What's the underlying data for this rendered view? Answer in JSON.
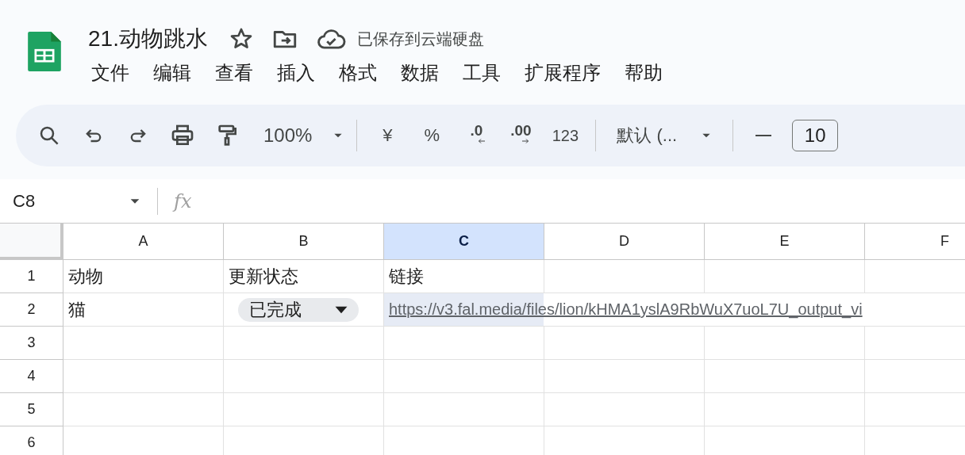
{
  "document": {
    "title": "21.动物跳水",
    "save_status": "已保存到云端硬盘"
  },
  "menu": [
    "文件",
    "编辑",
    "查看",
    "插入",
    "格式",
    "数据",
    "工具",
    "扩展程序",
    "帮助"
  ],
  "toolbar": {
    "zoom": "100%",
    "currency": "¥",
    "percent": "%",
    "decrease_decimal": ".0",
    "increase_decimal": ".00",
    "number_format": "123",
    "font": "默认 (...",
    "font_size": "10"
  },
  "formula_bar": {
    "cell_ref": "C8",
    "fx": "fx"
  },
  "sheet": {
    "columns": [
      {
        "label": "A",
        "selected": false
      },
      {
        "label": "B",
        "selected": false
      },
      {
        "label": "C",
        "selected": true
      },
      {
        "label": "D",
        "selected": false
      },
      {
        "label": "E",
        "selected": false
      },
      {
        "label": "F",
        "selected": false
      }
    ],
    "rows": [
      {
        "number": "1",
        "cells": [
          {
            "kind": "text",
            "text": "动物"
          },
          {
            "kind": "text",
            "text": "更新状态"
          },
          {
            "kind": "text",
            "text": "链接"
          }
        ]
      },
      {
        "number": "2",
        "cells": [
          {
            "kind": "text",
            "text": "猫"
          },
          {
            "kind": "chip",
            "text": "已完成"
          },
          {
            "kind": "link",
            "text": "https://v3.fal.media/files/lion/kHMA1yslA9RbWuX7uoL7U_output_vi",
            "selected": true
          }
        ]
      },
      {
        "number": "3"
      },
      {
        "number": "4"
      },
      {
        "number": "5"
      },
      {
        "number": "6"
      }
    ]
  }
}
